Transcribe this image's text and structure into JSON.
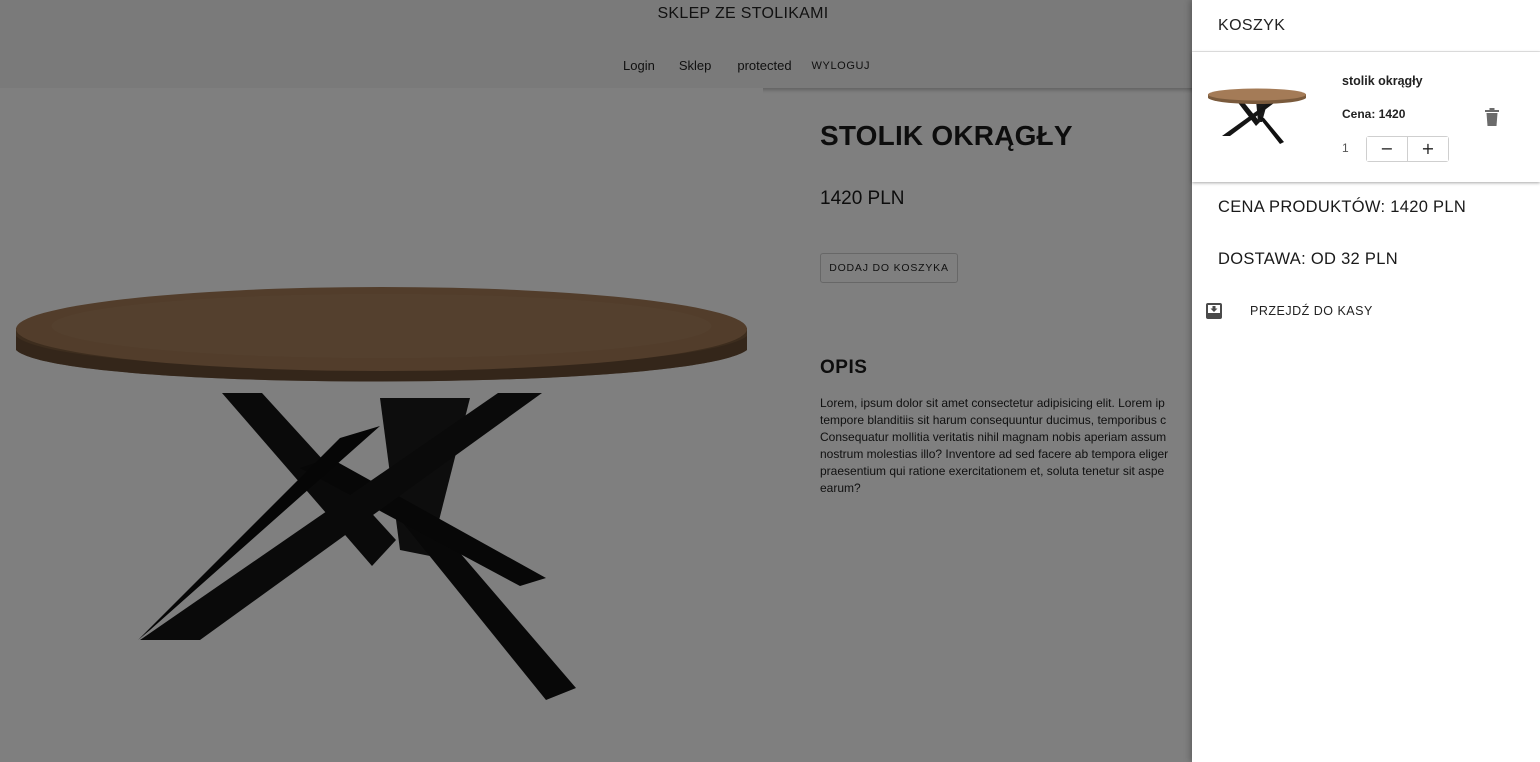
{
  "header": {
    "site_title": "SKLEP ZE STOLIKAMI",
    "nav": {
      "login": "Login",
      "shop": "Sklep",
      "protected": "protected",
      "logout": "WYLOGUJ"
    }
  },
  "product": {
    "title": "STOLIK OKRĄGŁY",
    "price": "1420 PLN",
    "add_to_cart_label": "DODAJ DO KOSZYKA",
    "description_heading": "OPIS",
    "description_lines": [
      "Lorem, ipsum dolor sit amet consectetur adipisicing elit. Lorem ip",
      "tempore blanditiis sit harum consequuntur ducimus, temporibus c",
      "Consequatur mollitia veritatis nihil magnam nobis aperiam assum",
      "nostrum molestias illo? Inventore ad sed facere ab tempora eliger",
      "praesentium qui ratione exercitationem et, soluta tenetur sit aspe",
      "earum?"
    ]
  },
  "cart": {
    "title": "KOSZYK",
    "items": [
      {
        "name": "stolik okrągły",
        "price": "Cena: 1420",
        "quantity": "1",
        "decrement_label": "−",
        "increment_label": "+"
      }
    ],
    "products_total": "CENA PRODUKTÓW: 1420 PLN",
    "shipping": "DOSTAWA: OD 32 PLN",
    "checkout_label": "PRZEJDŹ DO KASY",
    "icons": {
      "delete": "trash-icon",
      "checkout": "checkout-icon"
    }
  },
  "colors": {
    "overlay": "rgba(0,0,0,0.5)",
    "tabletop": "#a47b57",
    "table_legs": "#141414"
  }
}
